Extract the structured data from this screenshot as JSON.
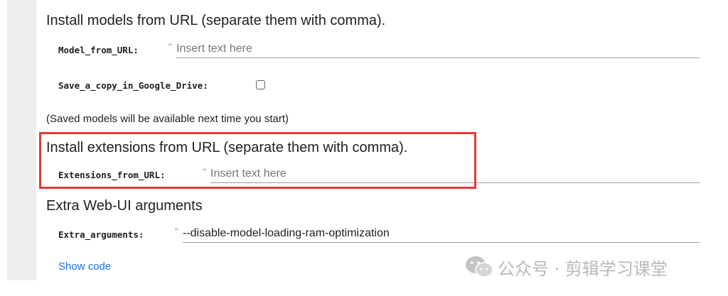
{
  "sections": {
    "models_heading": "Install models from URL (separate them with comma).",
    "model_field": {
      "label": "Model_from_URL:",
      "quote": "\"",
      "value": "",
      "placeholder": "Insert text here"
    },
    "drive_field": {
      "label": "Save_a_copy_in_Google_Drive:",
      "checked": false
    },
    "saved_note": "(Saved models will be available next time you start)",
    "extensions_heading": "Install extensions from URL (separate them with comma).",
    "extensions_field": {
      "label": "Extensions_from_URL:",
      "quote": "\"",
      "value": "",
      "placeholder": "Insert text here"
    },
    "webui_heading": "Extra Web-UI arguments",
    "extra_args_field": {
      "label": "Extra_arguments:",
      "quote": "\"",
      "value": "--disable-model-loading-ram-optimization"
    },
    "show_code": "Show code"
  },
  "watermark": {
    "text": "公众号 · 剪辑学习课堂",
    "icon": "wechat-icon"
  },
  "colors": {
    "highlight": "#e53935",
    "link": "#1a73e8",
    "gutter": "#eeeeee"
  }
}
